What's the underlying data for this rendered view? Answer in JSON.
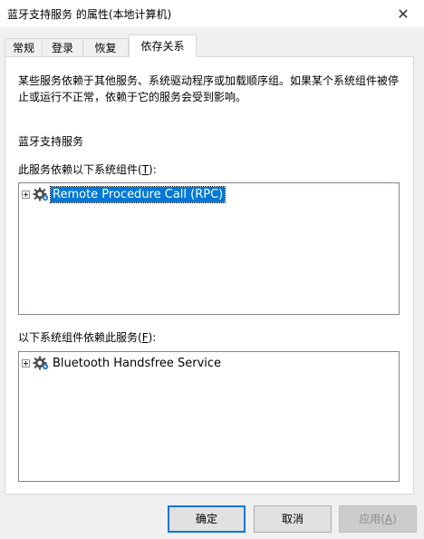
{
  "window": {
    "title": "蓝牙支持服务 的属性(本地计算机)",
    "close_glyph": "✕"
  },
  "tabs": [
    {
      "label": "常规",
      "active": false
    },
    {
      "label": "登录",
      "active": false
    },
    {
      "label": "恢复",
      "active": false
    },
    {
      "label": "依存关系",
      "active": true
    }
  ],
  "content": {
    "description": "某些服务依赖于其他服务、系统驱动程序或加载顺序组。如果某个系统组件被停止或运行不正常，依赖于它的服务会受到影响。",
    "service_name": "蓝牙支持服务",
    "depends_on_label": "此服务依赖以下系统组件(",
    "depends_on_key": "T",
    "depends_on_end": "):",
    "depends_on_items": [
      {
        "label": "Remote Procedure Call (RPC)",
        "selected": true,
        "icon": "gear-icon"
      }
    ],
    "dependents_label": "以下系统组件依赖此服务(",
    "dependents_key": "F",
    "dependents_end": "):",
    "dependents_items": [
      {
        "label": "Bluetooth Handsfree Service",
        "selected": false,
        "icon": "gear-icon"
      }
    ]
  },
  "buttons": {
    "ok": "确定",
    "cancel": "取消",
    "apply_prefix": "应用(",
    "apply_key": "A",
    "apply_suffix": ")"
  }
}
